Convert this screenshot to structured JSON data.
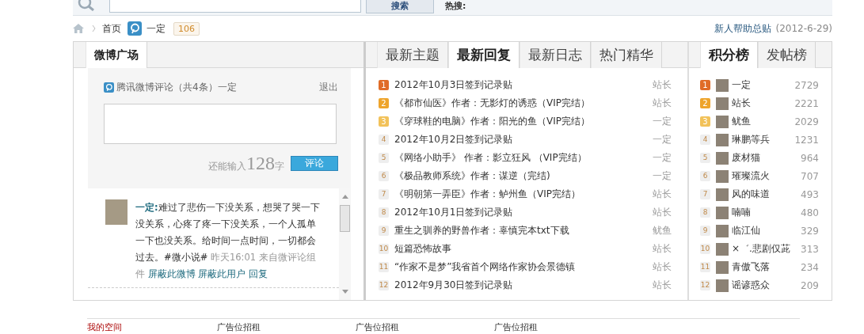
{
  "search_bar": {
    "button": "搜索",
    "hot_label": "热搜:"
  },
  "breadcrumb": {
    "home": "首页",
    "user": "一定",
    "count": "106",
    "help_link": "新人帮助总贴",
    "help_date": "(2012-6-29)"
  },
  "weibo_panel": {
    "tabs": [
      {
        "label": "微博广场",
        "selected": true
      }
    ],
    "widget_title": "腾讯微博评论（共4条）一定",
    "logout": "退出",
    "remaining_label": "还能输入",
    "remaining_count": "128",
    "remaining_unit": "字",
    "submit": "评论",
    "comments": [
      {
        "author": "一定:",
        "text": "难过了悲伤一下没关系，想哭了哭一下没关系，心疼了疼一下没关系，一个人孤单一下也没关系。给时间一点时间，一切都会过去。#微小说#",
        "time": "昨天16:01 来自微评论组件",
        "actions": [
          "屏蔽此微博",
          "屏蔽此用户",
          "回复"
        ]
      }
    ]
  },
  "threads": {
    "tabs": [
      {
        "label": "最新主题",
        "selected": false
      },
      {
        "label": "最新回复",
        "selected": true
      },
      {
        "label": "最新日志",
        "selected": false
      },
      {
        "label": "热门精华",
        "selected": false
      }
    ],
    "rows": [
      {
        "rank": "1",
        "color": "#e06c28",
        "title": "2012年10月3日签到记录贴",
        "author": "站长"
      },
      {
        "rank": "2",
        "color": "#eea42c",
        "title": "《都市仙医》作者：无影灯的诱惑（VIP完结）",
        "author": "站长"
      },
      {
        "rank": "3",
        "color": "#f2c25a",
        "title": "《穿球鞋的电脑》作者：阳光的鱼（VIP完结）",
        "author": "一定"
      },
      {
        "rank": "4",
        "color": "#eeeeee",
        "title": "2012年10月2日签到记录贴",
        "author": "一定"
      },
      {
        "rank": "5",
        "color": "#eeeeee",
        "title": "《网络小助手》 作者：影立狂风 （VIP完结）",
        "author": "一定"
      },
      {
        "rank": "6",
        "color": "#eeeeee",
        "title": "《极品教师系统》作者：谋逆（完结)",
        "author": "一定"
      },
      {
        "rank": "7",
        "color": "#eeeeee",
        "title": "《明朝第一弄臣》作者：鲈州鱼（VIP完结）",
        "author": "站长"
      },
      {
        "rank": "8",
        "color": "#eeeeee",
        "title": "2012年10月1日签到记录贴",
        "author": "站长"
      },
      {
        "rank": "9",
        "color": "#eeeeee",
        "title": "重生之驯养的野兽作者：辜慎完本txt下载",
        "author": "鱿鱼"
      },
      {
        "rank": "10",
        "color": "#eeeeee",
        "title": "短篇恐怖故事",
        "author": "站长"
      },
      {
        "rank": "11",
        "color": "#eeeeee",
        "title": "“作家不是梦”我省首个网络作家协会景德镇",
        "author": "站长"
      },
      {
        "rank": "12",
        "color": "#eeeeee",
        "title": "2012年9月30日签到记录贴",
        "author": "站长"
      }
    ]
  },
  "ranking": {
    "tabs": [
      {
        "label": "积分榜",
        "selected": true
      },
      {
        "label": "发帖榜",
        "selected": false
      }
    ],
    "rows": [
      {
        "rank": "1",
        "color": "#e06c28",
        "name": "一定",
        "score": "2729"
      },
      {
        "rank": "2",
        "color": "#eea42c",
        "name": "站长",
        "score": "2221"
      },
      {
        "rank": "3",
        "color": "#f2c25a",
        "name": "鱿鱼",
        "score": "2029"
      },
      {
        "rank": "4",
        "color": "#eeeeee",
        "name": "琳鹏等兵",
        "score": "1231"
      },
      {
        "rank": "5",
        "color": "#eeeeee",
        "name": "废材猫",
        "score": "964"
      },
      {
        "rank": "6",
        "color": "#eeeeee",
        "name": "璀璨流火",
        "score": "707"
      },
      {
        "rank": "7",
        "color": "#eeeeee",
        "name": "风的味道",
        "score": "493"
      },
      {
        "rank": "8",
        "color": "#eeeeee",
        "name": "喃喃",
        "score": "480"
      },
      {
        "rank": "9",
        "color": "#eeeeee",
        "name": "临江仙",
        "score": "329"
      },
      {
        "rank": "10",
        "color": "#eeeeee",
        "name": "×゛.悲剧仅茈",
        "score": "313"
      },
      {
        "rank": "11",
        "color": "#eeeeee",
        "name": "青傲飞落",
        "score": "234"
      },
      {
        "rank": "12",
        "color": "#eeeeee",
        "name": "谣谚惑众",
        "score": "209"
      }
    ]
  },
  "footer": {
    "links": [
      {
        "label": "我的空间",
        "kind": "red"
      },
      {
        "label": "广告位招租",
        "kind": "plain"
      },
      {
        "label": "广告位招租",
        "kind": "plain"
      },
      {
        "label": "广告位招租",
        "kind": "plain"
      }
    ]
  }
}
